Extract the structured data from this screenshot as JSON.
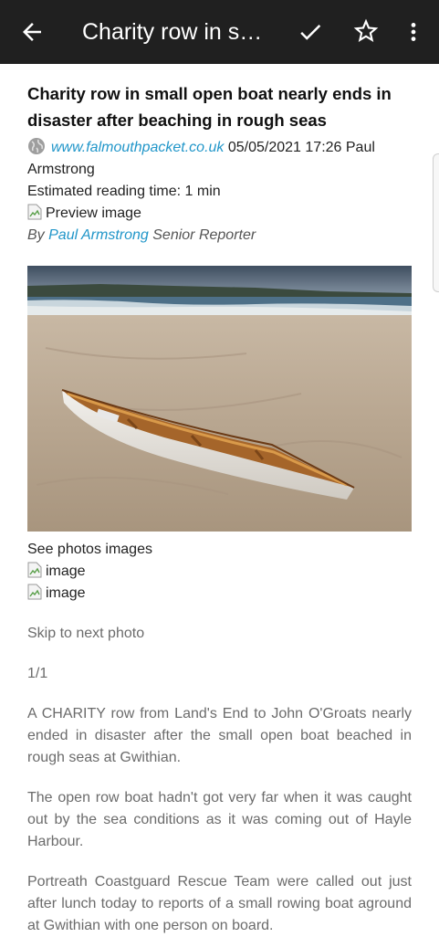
{
  "appbar": {
    "title": "Charity row in s…",
    "icons": [
      "arrow-back-icon",
      "check-icon",
      "star-outline-icon",
      "more-vert-icon"
    ]
  },
  "article": {
    "headline": "Charity row in small open boat nearly ends in disaster after beaching in rough seas",
    "source": "www.falmouthpacket.co.uk",
    "date_author": "05/05/2021 17:26 Paul Armstrong",
    "reading_time": "Estimated reading time: 1 min",
    "preview_alt": "Preview image",
    "byline_prefix": "By",
    "author": "Paul Armstrong",
    "author_role": "Senior Reporter",
    "see_photos": "See photos images",
    "image_alt_1": "image",
    "image_alt_2": "image",
    "skip": "Skip to next photo",
    "counter": "1/1",
    "paragraphs": [
      "A CHARITY row from Land's End to John O'Groats nearly ended in disaster after the small open boat beached in rough seas at Gwithian.",
      "The open row boat hadn't got very far when it was caught out by the sea conditions as it was coming out of Hayle Harbour.",
      "Portreath Coastguard Rescue Team were called out just after lunch today to reports of a small rowing boat aground at Gwithian with one person on board."
    ]
  },
  "colors": {
    "appbar": "#202020",
    "link": "#2196c9",
    "body_text": "#6b6b6b"
  }
}
